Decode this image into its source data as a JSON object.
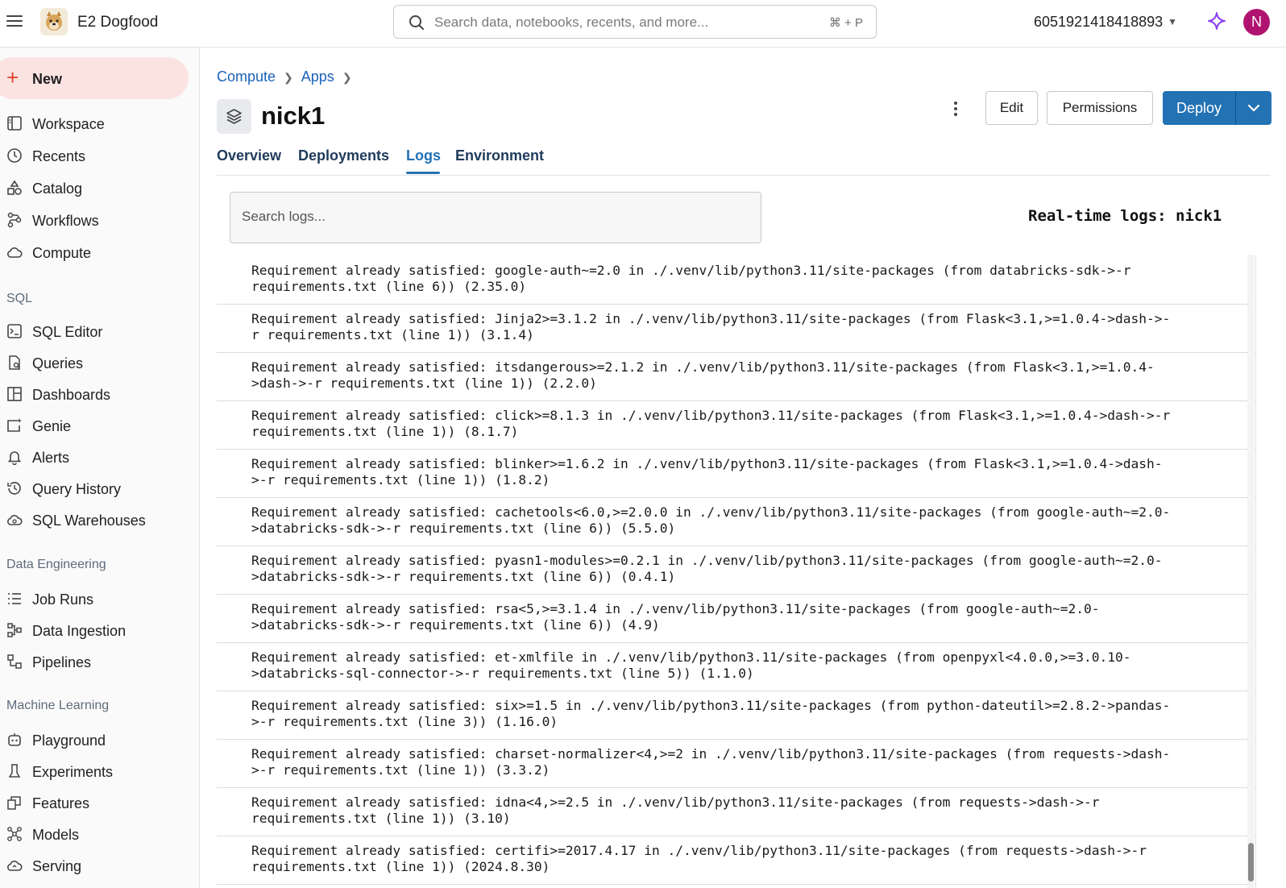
{
  "topbar": {
    "app_name": "E2 Dogfood",
    "search_placeholder": "Search data, notebooks, recents, and more...",
    "search_shortcut": "⌘ + P",
    "workspace_id": "6051921418418893",
    "avatar_initial": "N",
    "avatar_color": "#b0126f"
  },
  "sidebar": {
    "new_label": "New",
    "items": [
      {
        "label": "Workspace",
        "icon": "workspace-icon"
      },
      {
        "label": "Recents",
        "icon": "clock-icon"
      },
      {
        "label": "Catalog",
        "icon": "catalog-icon"
      },
      {
        "label": "Workflows",
        "icon": "workflows-icon"
      },
      {
        "label": "Compute",
        "icon": "cloud-icon"
      }
    ],
    "sql_section": "SQL",
    "sql_items": [
      {
        "label": "SQL Editor",
        "icon": "sql-editor-icon"
      },
      {
        "label": "Queries",
        "icon": "queries-icon"
      },
      {
        "label": "Dashboards",
        "icon": "dashboards-icon"
      },
      {
        "label": "Genie",
        "icon": "genie-icon"
      },
      {
        "label": "Alerts",
        "icon": "bell-icon"
      },
      {
        "label": "Query History",
        "icon": "history-icon"
      },
      {
        "label": "SQL Warehouses",
        "icon": "warehouse-icon"
      }
    ],
    "de_section": "Data Engineering",
    "de_items": [
      {
        "label": "Job Runs",
        "icon": "job-runs-icon"
      },
      {
        "label": "Data Ingestion",
        "icon": "ingestion-icon"
      },
      {
        "label": "Pipelines",
        "icon": "pipelines-icon"
      }
    ],
    "ml_section": "Machine Learning",
    "ml_items": [
      {
        "label": "Playground",
        "icon": "playground-icon"
      },
      {
        "label": "Experiments",
        "icon": "flask-icon"
      },
      {
        "label": "Features",
        "icon": "features-icon"
      },
      {
        "label": "Models",
        "icon": "models-icon"
      },
      {
        "label": "Serving",
        "icon": "serving-icon"
      }
    ]
  },
  "breadcrumb": [
    "Compute",
    "Apps"
  ],
  "app": {
    "title": "nick1",
    "edit_label": "Edit",
    "permissions_label": "Permissions",
    "deploy_label": "Deploy",
    "accent_color": "#2272b4"
  },
  "tabs": [
    "Overview",
    "Deployments",
    "Logs",
    "Environment"
  ],
  "active_tab": "Logs",
  "logs": {
    "search_placeholder": "Search logs...",
    "realtime_title": "Real-time logs: nick1",
    "lines": [
      "Requirement already satisfied: google-auth~=2.0 in ./.venv/lib/python3.11/site-packages (from databricks-sdk->-r\nrequirements.txt (line 6)) (2.35.0)",
      "Requirement already satisfied: Jinja2>=3.1.2 in ./.venv/lib/python3.11/site-packages (from Flask<3.1,>=1.0.4->dash->-\nr requirements.txt (line 1)) (3.1.4)",
      "Requirement already satisfied: itsdangerous>=2.1.2 in ./.venv/lib/python3.11/site-packages (from Flask<3.1,>=1.0.4-\n>dash->-r requirements.txt (line 1)) (2.2.0)",
      "Requirement already satisfied: click>=8.1.3 in ./.venv/lib/python3.11/site-packages (from Flask<3.1,>=1.0.4->dash->-r\nrequirements.txt (line 1)) (8.1.7)",
      "Requirement already satisfied: blinker>=1.6.2 in ./.venv/lib/python3.11/site-packages (from Flask<3.1,>=1.0.4->dash-\n>-r requirements.txt (line 1)) (1.8.2)",
      "Requirement already satisfied: cachetools<6.0,>=2.0.0 in ./.venv/lib/python3.11/site-packages (from google-auth~=2.0-\n>databricks-sdk->-r requirements.txt (line 6)) (5.5.0)",
      "Requirement already satisfied: pyasn1-modules>=0.2.1 in ./.venv/lib/python3.11/site-packages (from google-auth~=2.0-\n>databricks-sdk->-r requirements.txt (line 6)) (0.4.1)",
      "Requirement already satisfied: rsa<5,>=3.1.4 in ./.venv/lib/python3.11/site-packages (from google-auth~=2.0-\n>databricks-sdk->-r requirements.txt (line 6)) (4.9)",
      "Requirement already satisfied: et-xmlfile in ./.venv/lib/python3.11/site-packages (from openpyxl<4.0.0,>=3.0.10-\n>databricks-sql-connector->-r requirements.txt (line 5)) (1.1.0)",
      "Requirement already satisfied: six>=1.5 in ./.venv/lib/python3.11/site-packages (from python-dateutil>=2.8.2->pandas-\n>-r requirements.txt (line 3)) (1.16.0)",
      "Requirement already satisfied: charset-normalizer<4,>=2 in ./.venv/lib/python3.11/site-packages (from requests->dash-\n>-r requirements.txt (line 1)) (3.3.2)",
      "Requirement already satisfied: idna<4,>=2.5 in ./.venv/lib/python3.11/site-packages (from requests->dash->-r\nrequirements.txt (line 1)) (3.10)",
      "Requirement already satisfied: certifi>=2017.4.17 in ./.venv/lib/python3.11/site-packages (from requests->dash->-r\nrequirements.txt (line 1)) (2024.8.30)"
    ]
  }
}
